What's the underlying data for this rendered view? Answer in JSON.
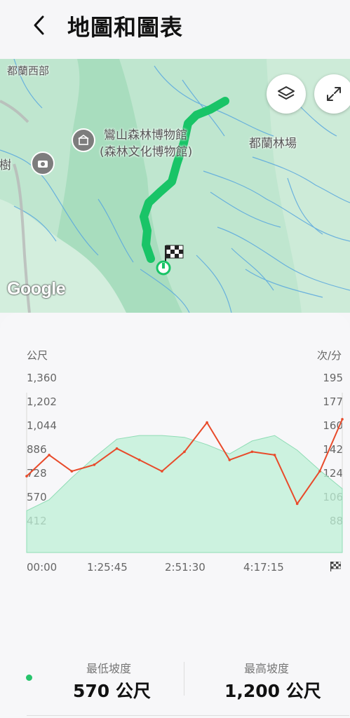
{
  "header": {
    "title": "地圖和圖表"
  },
  "map": {
    "labels": {
      "area_top_left": "都蘭西部",
      "poi_line1": "鸞山森林博物館",
      "poi_line2": "(森林文化博物館)",
      "forest_farm": "都蘭林場",
      "left_edge": "榕樹"
    },
    "attribution": "Google"
  },
  "chart": {
    "left_unit": "公尺",
    "right_unit": "次/分",
    "left_ticks": [
      "1,360",
      "1,202",
      "1,044",
      "886",
      "728",
      "570",
      "412"
    ],
    "right_ticks": [
      "195",
      "177",
      "160",
      "142",
      "124",
      "106",
      "88"
    ],
    "x_ticks": [
      "00:00",
      "1:25:45",
      "2:51:30",
      "4:17:15"
    ]
  },
  "chart_data": {
    "type": "area",
    "x_unit": "elapsed time",
    "y_left_label": "公尺",
    "y_right_label": "次/分",
    "y_left_lim": [
      412,
      1360
    ],
    "y_right_lim": [
      88,
      195
    ],
    "x_ticks": [
      "00:00",
      "1:25:45",
      "2:51:30",
      "4:17:15"
    ],
    "series": [
      {
        "type": "area",
        "axis": "left",
        "color": "#bdf0d6",
        "x": [
          "00:00",
          "0:21",
          "0:43",
          "1:04",
          "1:26",
          "1:47",
          "2:08",
          "2:30",
          "2:51",
          "3:13",
          "3:34",
          "3:56",
          "4:17",
          "4:38",
          "5:00"
        ],
        "values": [
          640,
          700,
          820,
          930,
          1030,
          1050,
          1050,
          1040,
          1000,
          950,
          1020,
          1050,
          970,
          860,
          760
        ]
      },
      {
        "type": "line",
        "axis": "right",
        "color": "#e84a2a",
        "x": [
          "00:00",
          "0:21",
          "0:43",
          "1:04",
          "1:26",
          "1:47",
          "2:08",
          "2:30",
          "2:51",
          "3:13",
          "3:34",
          "3:56",
          "4:17",
          "4:38",
          "5:00"
        ],
        "values": [
          135,
          148,
          138,
          142,
          152,
          145,
          138,
          150,
          168,
          145,
          150,
          148,
          118,
          138,
          170
        ]
      }
    ]
  },
  "stats": {
    "min_label": "最低坡度",
    "min_value": "570 公尺",
    "max_label": "最高坡度",
    "max_value": "1,200 公尺"
  }
}
